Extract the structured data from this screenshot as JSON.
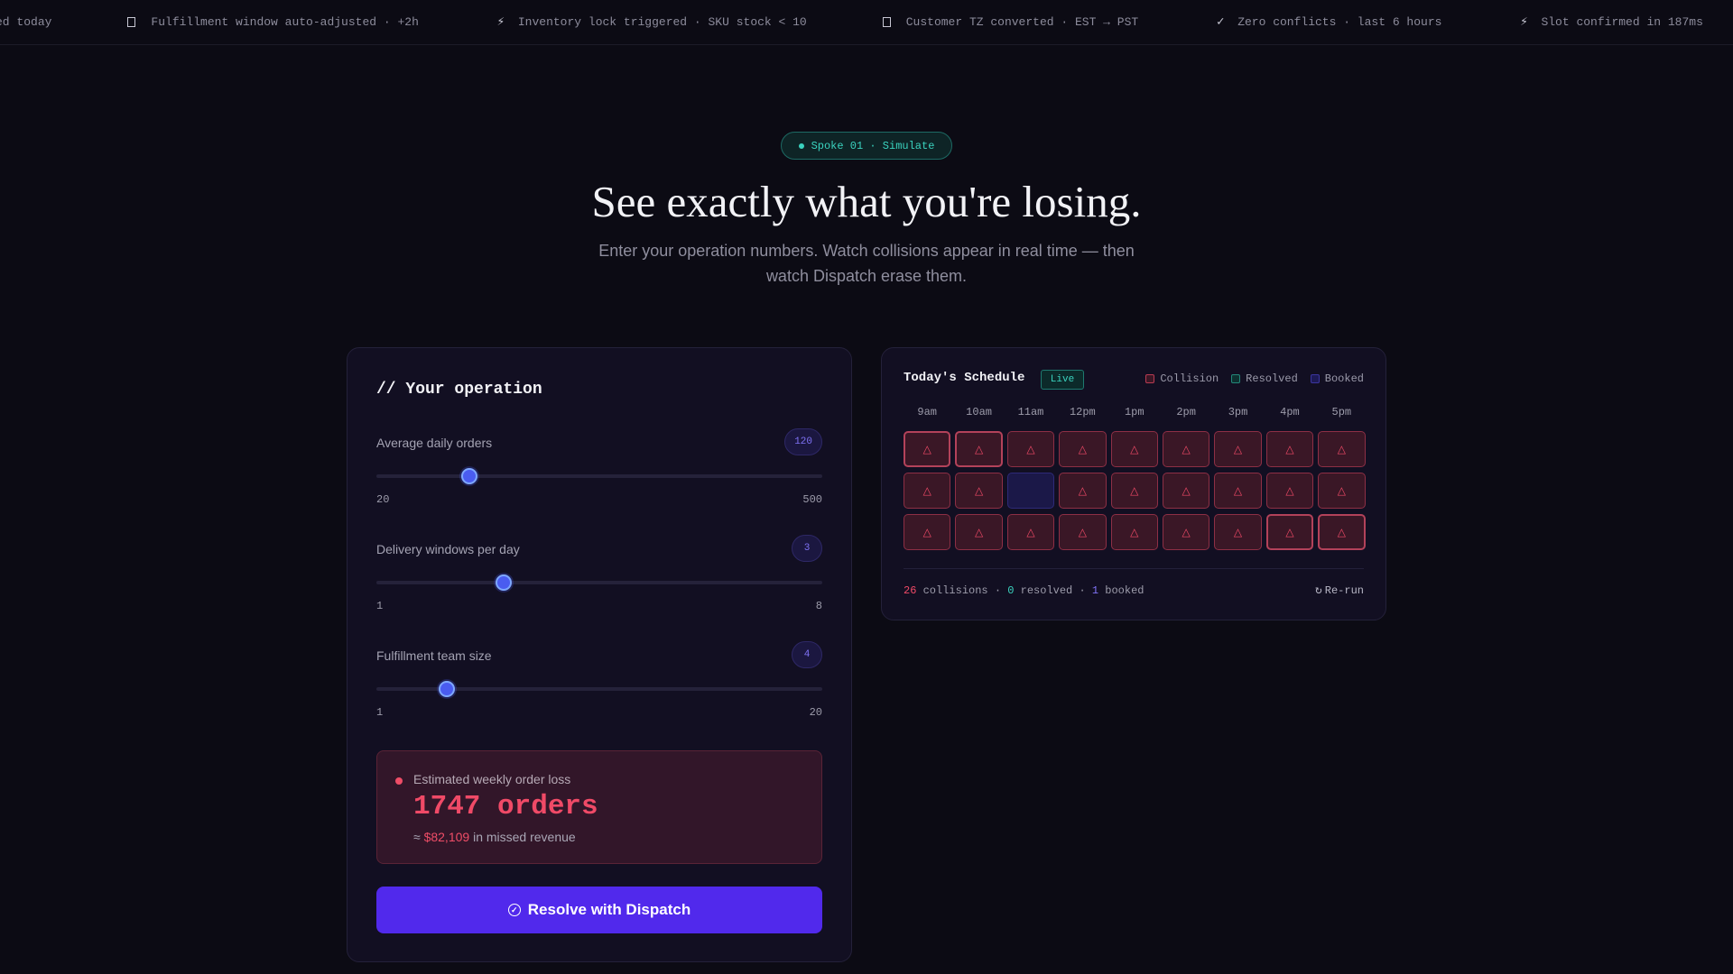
{
  "ticker": {
    "items": [
      {
        "icon": "check-icon",
        "glyph": "",
        "text": "patched today"
      },
      {
        "icon": "calendar-icon",
        "glyph": "box",
        "text": "Fulfillment window auto-adjusted · +2h"
      },
      {
        "icon": "bolt-icon",
        "glyph": "⚡",
        "text": "Inventory lock triggered · SKU stock < 10"
      },
      {
        "icon": "calendar-icon",
        "glyph": "box",
        "text": "Customer TZ converted · EST → PST"
      },
      {
        "icon": "check-icon",
        "glyph": "✓",
        "text": "Zero conflicts · last 6 hours"
      },
      {
        "icon": "bolt-icon",
        "glyph": "⚡",
        "text": "Slot confirmed in 187ms"
      }
    ]
  },
  "hero": {
    "badge": "Spoke 01 · Simulate",
    "title": "See exactly what you're losing.",
    "subtitle": "Enter your operation numbers. Watch collisions appear in real time — then watch Dispatch erase them."
  },
  "operation": {
    "title": "// Your operation",
    "fields": [
      {
        "label": "Average daily orders",
        "value": "120",
        "min": "20",
        "max": "500",
        "fraction": 0.208
      },
      {
        "label": "Delivery windows per day",
        "value": "3",
        "min": "1",
        "max": "8",
        "fraction": 0.286
      },
      {
        "label": "Fulfillment team size",
        "value": "4",
        "min": "1",
        "max": "20",
        "fraction": 0.158
      }
    ],
    "loss": {
      "label": "Estimated weekly order loss",
      "value": "1747 orders",
      "revenue_prefix": "≈ ",
      "revenue_amount": "$82,109",
      "revenue_suffix": " in missed revenue"
    },
    "resolve_label": "Resolve with Dispatch"
  },
  "schedule": {
    "title": "Today's Schedule",
    "live_label": "Live",
    "legend": {
      "collision": "Collision",
      "resolved": "Resolved",
      "booked": "Booked"
    },
    "times": [
      "9am",
      "10am",
      "11am",
      "12pm",
      "1pm",
      "2pm",
      "3pm",
      "4pm",
      "5pm"
    ],
    "rows": [
      [
        "collision-hot",
        "collision-hot",
        "collision",
        "collision",
        "collision",
        "collision",
        "collision",
        "collision",
        "collision"
      ],
      [
        "collision",
        "collision",
        "booked",
        "collision",
        "collision",
        "collision",
        "collision",
        "collision",
        "collision"
      ],
      [
        "collision",
        "collision",
        "collision",
        "collision",
        "collision",
        "collision",
        "collision",
        "collision-hot",
        "collision-hot"
      ]
    ],
    "stats": {
      "collisions": "26",
      "collisions_label": " collisions · ",
      "resolved": "0",
      "resolved_label": " resolved · ",
      "booked": "1",
      "booked_label": " booked"
    },
    "rerun_label": "Re-run"
  },
  "colors": {
    "accent": "#5129ec",
    "collision": "#f04a67",
    "resolved": "#3ad2be",
    "booked": "#7f72f5"
  }
}
